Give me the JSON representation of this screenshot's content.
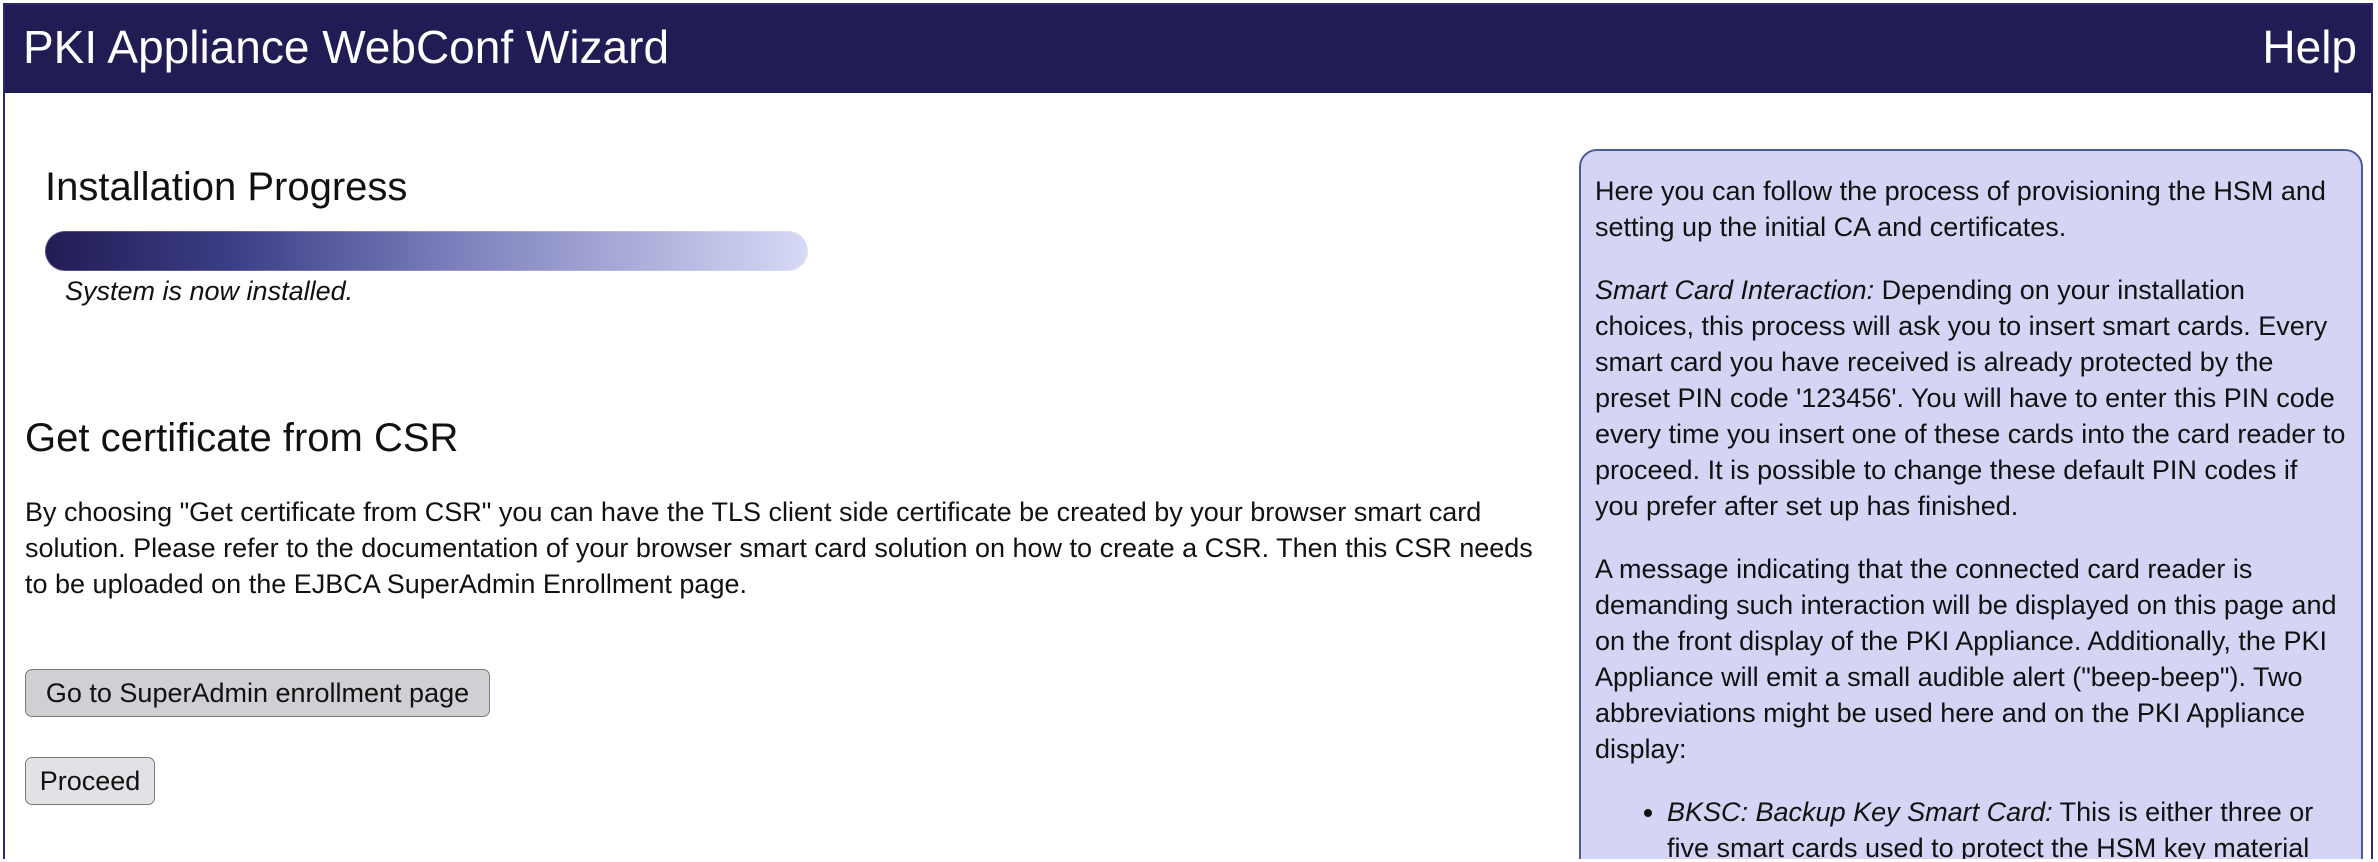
{
  "header": {
    "title": "PKI Appliance WebConf Wizard",
    "help_label": "Help"
  },
  "progress": {
    "heading": "Installation Progress",
    "status": "System is now installed.",
    "complete": 1.0
  },
  "csr": {
    "heading": "Get certificate from CSR",
    "description": "By choosing \"Get certificate from CSR\" you can have the TLS client side certificate be created by your browser smart card solution. Please refer to the documentation of your browser smart card solution on how to create a CSR. Then this CSR needs to be uploaded on the EJBCA SuperAdmin Enrollment page.",
    "enroll_button": "Go to SuperAdmin enrollment page",
    "proceed_button": "Proceed"
  },
  "help_panel": {
    "intro": "Here you can follow the process of provisioning the HSM and setting up the initial CA and certificates.",
    "smartcard_label": "Smart Card Interaction:",
    "smartcard_text": " Depending on your installation choices, this process will ask you to insert smart cards. Every smart card you have received is already protected by the preset PIN code '123456'. You will have to enter this PIN code every time you insert one of these cards into the card reader to proceed. It is possible to change these default PIN codes if you prefer after set up has finished.",
    "message_text": "A message indicating that the connected card reader is demanding such interaction will be displayed on this page and on the front display of the PKI Appliance. Additionally, the PKI Appliance will emit a small audible alert (\"beep-beep\"). Two abbreviations might be used here and on the PKI Appliance display:",
    "bksc_label": "BKSC: Backup Key Smart Card:",
    "bksc_text": " This is either three or five smart cards used to protect the HSM key material"
  }
}
